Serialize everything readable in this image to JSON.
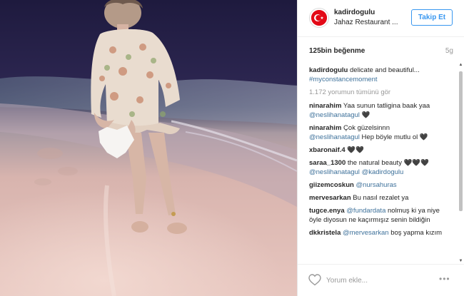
{
  "post": {
    "username": "kadirdogulu",
    "location": "Jahaz Restaurant ...",
    "follow_label": "Takip Et",
    "likes": "125bin beğenme",
    "time": "5g",
    "caption": {
      "user": "kadirdogulu",
      "text": " delicate and beautiful...",
      "hashtag": "#myconstancemoment"
    },
    "view_all": "1.172 yorumun tümünü gör",
    "comments": [
      {
        "user": "ninarahim",
        "pre": " Yaa sunun tatligina baak yaa ",
        "mentions": [
          "@neslihanatagul"
        ],
        "post": " 🖤"
      },
      {
        "user": "ninarahim",
        "pre": " Çok güzelsinnn ",
        "mentions": [
          "@neslihanatagul"
        ],
        "post": " Hep böyle mutlu ol 🖤"
      },
      {
        "user": "xbaronaif.4",
        "pre": " 🖤🖤",
        "mentions": [],
        "post": ""
      },
      {
        "user": "saraa_1300",
        "pre": " the natural beauty 🖤🖤🖤 ",
        "mentions": [
          "@neslihanatagul",
          "@kadirdogulu"
        ],
        "post": ""
      },
      {
        "user": "giizemcoskun",
        "pre": " ",
        "mentions": [
          "@nursahuras"
        ],
        "post": ""
      },
      {
        "user": "mervesarkan",
        "pre": " Bu nasıl rezalet ya",
        "mentions": [],
        "post": ""
      },
      {
        "user": "tugce.enya",
        "pre": " ",
        "mentions": [
          "@fundardata"
        ],
        "post": " nolmuş ki ya niye öyle diyosun ne kaçırmışız senin bildiğin"
      },
      {
        "user": "dkkristela",
        "pre": " ",
        "mentions": [
          "@mervesarkan"
        ],
        "post": " boş yapma kızım"
      }
    ],
    "comment_placeholder": "Yorum ekle...",
    "more_label": "•••"
  },
  "icons": {
    "heart": "heart-icon",
    "more": "more-options-icon",
    "avatar_flag": "turkey-flag-icon"
  },
  "colors": {
    "link": "#3f729b",
    "follow": "#3897f0",
    "muted": "#999999"
  }
}
